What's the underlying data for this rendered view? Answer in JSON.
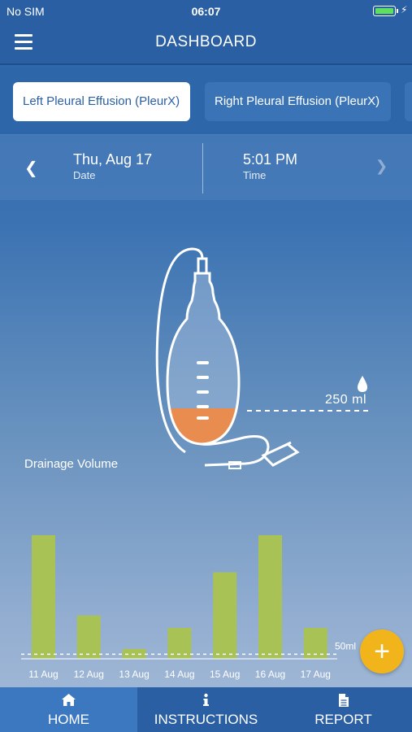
{
  "status": {
    "carrier": "No SIM",
    "time": "06:07"
  },
  "header": {
    "title": "DASHBOARD"
  },
  "tabs": [
    {
      "label": "Left Pleural Effusion (PleurX)",
      "active": true
    },
    {
      "label": "Right Pleural Effusion (PleurX)",
      "active": false
    }
  ],
  "session": {
    "date_value": "Thu, Aug 17",
    "date_label": "Date",
    "time_value": "5:01 PM",
    "time_label": "Time"
  },
  "bottle": {
    "volume_label": "250 ml"
  },
  "section": {
    "drainage_title": "Drainage Volume"
  },
  "chart_data": {
    "type": "bar",
    "categories": [
      "11 Aug",
      "12 Aug",
      "13 Aug",
      "14 Aug",
      "15 Aug",
      "16 Aug",
      "17 Aug"
    ],
    "values": [
      1000,
      350,
      80,
      250,
      700,
      1000,
      250
    ],
    "reference_line": {
      "value": 50,
      "label": "50ml"
    },
    "bar_color": "#a8c256"
  },
  "fab": {
    "icon": "plus-icon"
  },
  "tabbar": {
    "items": [
      {
        "label": "HOME",
        "icon": "home-icon",
        "active": true
      },
      {
        "label": "INSTRUCTIONS",
        "icon": "info-icon",
        "active": false
      },
      {
        "label": "REPORT",
        "icon": "document-icon",
        "active": false
      }
    ]
  },
  "colors": {
    "brand": "#2a5fa3",
    "accent": "#f2b41b",
    "fluid": "#e98c50"
  }
}
